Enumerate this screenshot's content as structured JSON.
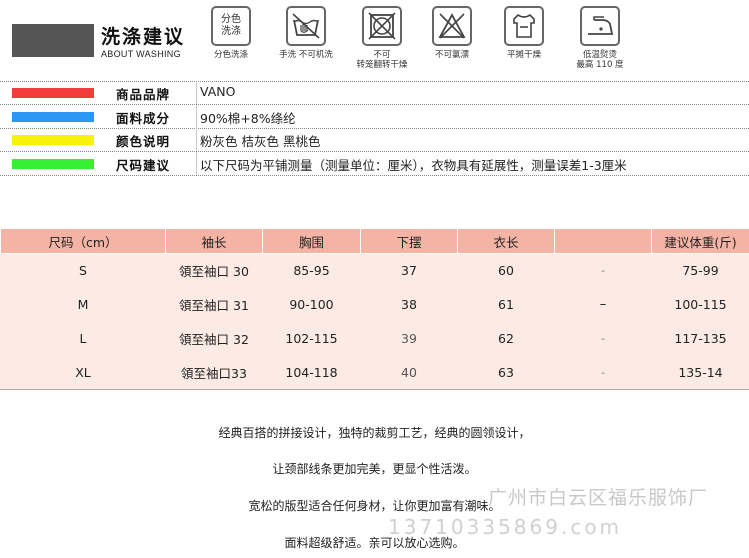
{
  "header": {
    "title": "洗涤建议",
    "subtitle": "ABOUT WASHING"
  },
  "care_icons": [
    {
      "icon": "wash-separately-icon",
      "box_text_line1": "分色",
      "box_text_line2": "洗涤",
      "label_line1": "分色洗涤",
      "label_line2": ""
    },
    {
      "icon": "hand-wash-no-machine-icon",
      "label_line1": "手洗 不可机洗",
      "label_line2": ""
    },
    {
      "icon": "no-tumble-dry-icon",
      "label_line1": "不可",
      "label_line2": "转笼翻转干燥"
    },
    {
      "icon": "no-bleach-icon",
      "label_line1": "不可氯漂",
      "label_line2": ""
    },
    {
      "icon": "dry-flat-icon",
      "label_line1": "平摊干燥",
      "label_line2": ""
    },
    {
      "icon": "low-temp-iron-icon",
      "label_line1": "低温熨烫",
      "label_line2": "最高 110 度"
    }
  ],
  "info": [
    {
      "color": "#f23b3b",
      "label": "商品品牌",
      "value": "VANO"
    },
    {
      "color": "#2e96f5",
      "label": "面料成分",
      "value": "90%棉+8%绦纶"
    },
    {
      "color": "#f7f20a",
      "label": "颜色说明",
      "value": "粉灰色 桔灰色 黑桃色"
    },
    {
      "color": "#35f035",
      "label": "尺码建议",
      "value": "以下尺码为平铺测量（测量单位：厘米），衣物具有延展性，测量误差1-3厘米"
    }
  ],
  "size_table": {
    "headers": [
      "尺码（cm）",
      "袖长",
      "胸围",
      "下摆",
      "衣长",
      "",
      "建议体重(斤)"
    ],
    "rows": [
      [
        "S",
        "領至袖口 30",
        "85-95",
        "37",
        "60",
        "-",
        "75-99"
      ],
      [
        "M",
        "領至袖口 31",
        "90-100",
        "38",
        "61",
        "–",
        "100-115"
      ],
      [
        "L",
        "領至袖口 32",
        "102-115",
        "39",
        "62",
        "-",
        "117-135"
      ],
      [
        "XL",
        "領至袖口33",
        "104-118",
        "40",
        "63",
        "-",
        "135-14"
      ]
    ]
  },
  "description": [
    "经典百搭的拼接设计，独特的裁剪工艺，经典的圆领设计，",
    "让颈部线条更加完美，更显个性活泼。",
    "宽松的版型适合任何身材，让你更加富有潮味。",
    "面料超级舒适。亲可以放心选购。"
  ],
  "watermark": {
    "company": "广州市白云区福乐服饰厂",
    "phone": "13710335869.com"
  }
}
